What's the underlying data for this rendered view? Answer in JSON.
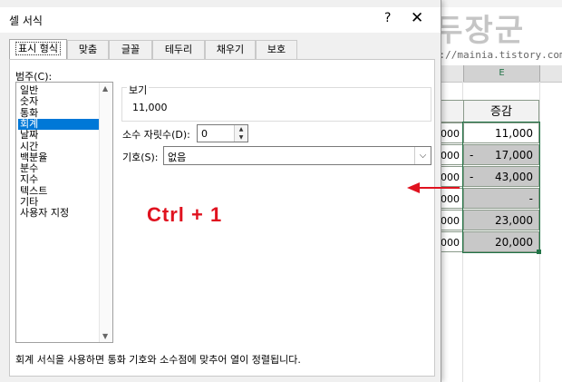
{
  "dialog": {
    "title": "셀 서식",
    "help_glyph": "?",
    "close_glyph": "✕",
    "tabs": [
      {
        "label": "표시 형식",
        "active": true
      },
      {
        "label": "맞춤"
      },
      {
        "label": "글꼴"
      },
      {
        "label": "테두리"
      },
      {
        "label": "채우기"
      },
      {
        "label": "보호"
      }
    ],
    "category_label": "범주(C):",
    "categories": [
      "일반",
      "숫자",
      "통화",
      "회계",
      "날짜",
      "시간",
      "백분율",
      "분수",
      "지수",
      "텍스트",
      "기타",
      "사용자 지정"
    ],
    "selected_category": "회계",
    "preview": {
      "label": "보기",
      "value": "11,000"
    },
    "decimal_places": {
      "label": "소수 자릿수(D):",
      "value": "0"
    },
    "symbol": {
      "label": "기호(S):",
      "value": "없음"
    },
    "description": "회계 서식을 사용하면 통화 기호와 소수점에 맞추어 열이 정렬됩니다."
  },
  "annotation": {
    "text": "Ctrl  +  1",
    "color": "#e0121f"
  },
  "watermark": {
    "title": "녹두장군",
    "url": "http://mainia.tistory.com"
  },
  "sheet": {
    "column_label": "E",
    "header_text": "증감",
    "rows": [
      {
        "left": "000",
        "dash": "",
        "value": "11,000",
        "fill": "white"
      },
      {
        "left": "000",
        "dash": "-",
        "value": "17,000",
        "fill": "gray"
      },
      {
        "left": "000",
        "dash": "-",
        "value": "43,000",
        "fill": "gray"
      },
      {
        "left": "000",
        "dash": "",
        "value": "-",
        "fill": "gray"
      },
      {
        "left": "000",
        "dash": "",
        "value": "23,000",
        "fill": "gray"
      },
      {
        "left": "000",
        "dash": "",
        "value": "20,000",
        "fill": "gray"
      }
    ],
    "accent": "#217346"
  }
}
